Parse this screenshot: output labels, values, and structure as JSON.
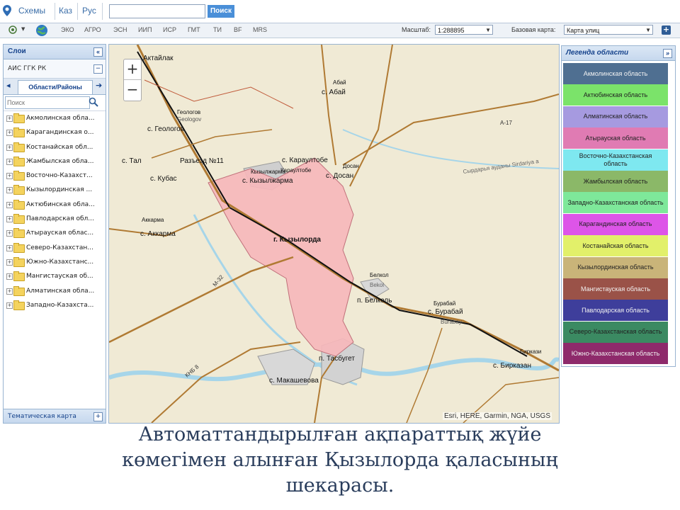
{
  "header": {
    "nav": [
      "Схемы",
      "Каз",
      "Рус"
    ],
    "search_placeholder": "",
    "search_button": "Поиск"
  },
  "toolbar": {
    "layers": [
      "ЭКО",
      "АГРО",
      "ЭСН",
      "ИИП",
      "ИСР",
      "ГМТ",
      "ТИ",
      "BF",
      "MRS"
    ],
    "scale_label": "Масштаб:",
    "scale_value": "1:288895",
    "basemap_label": "Базовая карта:",
    "basemap_value": "Карта улиц"
  },
  "left_panel": {
    "title": "Слои",
    "section": "АИС ГГК РК",
    "tab": "Области/Районы",
    "search_placeholder": "Поиск",
    "items": [
      "Акмолинская обла...",
      "Карагандинская о...",
      "Костанайская обл...",
      "Жамбылская обла...",
      "Восточно-Казахст...",
      "Кызылординская ...",
      "Актюбинская обла...",
      "Павлодарская обл...",
      "Атырауская облас...",
      "Северо-Казахстан...",
      "Южно-Казахстанс...",
      "Мангистауская об...",
      "Алматинская обла...",
      "Западно-Казахста..."
    ],
    "bottom": "Тематическая карта"
  },
  "map": {
    "zoom_in": "+",
    "zoom_out": "−",
    "attribution": "Esri, HERE, Garmin, NGA, USGS",
    "labels": [
      "Актайлак",
      "с. Абай",
      "Абай",
      "Геологов",
      "Geologov",
      "с. Геологов",
      "с. Тал",
      "Разъезд №11",
      "с. Кубас",
      "с. Караултобе",
      "Караултобе",
      "с. Досан",
      "Досан",
      "Сырдарья ауданы Sirdariya a",
      "с. Кызылжарма",
      "Кызылжарма",
      "Аккарма",
      "с. Аккарма",
      "г. Кызылорда",
      "Белкол",
      "Bekol",
      "п. Белколь",
      "с. Бурабай",
      "Бурабай",
      "Burabay",
      "Биркази",
      "с. Бирказан",
      "п. Тасбугет",
      "с. Макашевова",
      "А-17",
      "М-32",
      "КНБ 8"
    ]
  },
  "legend": {
    "title": "Легенда области",
    "items": [
      {
        "label": "Акмолинская область",
        "color": "#4f6f91"
      },
      {
        "label": "Актюбинская область",
        "color": "#7be36a"
      },
      {
        "label": "Алматинская область",
        "color": "#a69ae0"
      },
      {
        "label": "Атырауская область",
        "color": "#e07bb3"
      },
      {
        "label": "Восточно-Казахстанская область",
        "color": "#7ee8f0"
      },
      {
        "label": "Жамбылская область",
        "color": "#8bb868"
      },
      {
        "label": "Западно-Казахстанская область",
        "color": "#7ee89a"
      },
      {
        "label": "Карагандинская область",
        "color": "#dd55e8"
      },
      {
        "label": "Костанайская область",
        "color": "#e2f06a"
      },
      {
        "label": "Кызылординская область",
        "color": "#c9b479"
      },
      {
        "label": "Мангистауская область",
        "color": "#9a5248"
      },
      {
        "label": "Павлодарская область",
        "color": "#3e3e9b"
      },
      {
        "label": "Северо-Казахстанская область",
        "color": "#3b8a62"
      },
      {
        "label": "Южно-Казахстанская область",
        "color": "#8e2a6b"
      }
    ]
  },
  "caption": {
    "line1": "Автоматтандырылған ақпараттық жүйе",
    "line2": "көмегімен алынған Қызылорда қаласының",
    "line3": "шекарасы."
  }
}
